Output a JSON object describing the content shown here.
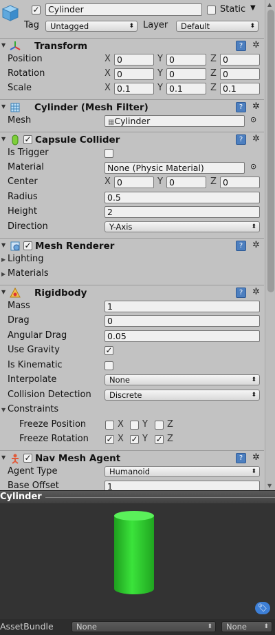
{
  "header": {
    "object_name": "Cylinder",
    "static_label": "Static",
    "tag_label": "Tag",
    "tag_value": "Untagged",
    "layer_label": "Layer",
    "layer_value": "Default"
  },
  "transform": {
    "title": "Transform",
    "position_label": "Position",
    "position": {
      "x": "0",
      "y": "0",
      "z": "0"
    },
    "rotation_label": "Rotation",
    "rotation": {
      "x": "0",
      "y": "0",
      "z": "0"
    },
    "scale_label": "Scale",
    "scale": {
      "x": "0.1",
      "y": "0.1",
      "z": "0.1"
    }
  },
  "axes": {
    "x": "X",
    "y": "Y",
    "z": "Z"
  },
  "mesh_filter": {
    "title": "Cylinder (Mesh Filter)",
    "mesh_label": "Mesh",
    "mesh_value": "Cylinder"
  },
  "capsule_collider": {
    "title": "Capsule Collider",
    "is_trigger_label": "Is Trigger",
    "material_label": "Material",
    "material_value": "None (Physic Material)",
    "center_label": "Center",
    "center": {
      "x": "0",
      "y": "0",
      "z": "0"
    },
    "radius_label": "Radius",
    "radius": "0.5",
    "height_label": "Height",
    "height": "2",
    "direction_label": "Direction",
    "direction": "Y-Axis"
  },
  "mesh_renderer": {
    "title": "Mesh Renderer",
    "lighting_label": "Lighting",
    "materials_label": "Materials"
  },
  "rigidbody": {
    "title": "Rigidbody",
    "mass_label": "Mass",
    "mass": "1",
    "drag_label": "Drag",
    "drag": "0",
    "angular_drag_label": "Angular Drag",
    "angular_drag": "0.05",
    "use_gravity_label": "Use Gravity",
    "is_kinematic_label": "Is Kinematic",
    "interpolate_label": "Interpolate",
    "interpolate": "None",
    "collision_label": "Collision Detection",
    "collision": "Discrete",
    "constraints_label": "Constraints",
    "freeze_position_label": "Freeze Position",
    "freeze_rotation_label": "Freeze Rotation"
  },
  "nav_mesh_agent": {
    "title": "Nav Mesh Agent",
    "agent_type_label": "Agent Type",
    "agent_type": "Humanoid",
    "base_offset_label": "Base Offset",
    "base_offset": "1"
  },
  "preview": {
    "title": "Cylinder",
    "cylinder_color": "#2fd32f"
  },
  "footer": {
    "assetbundle_label": "AssetBundle",
    "bundle_value": "None",
    "variant_value": "None"
  },
  "checkmark": "✓"
}
